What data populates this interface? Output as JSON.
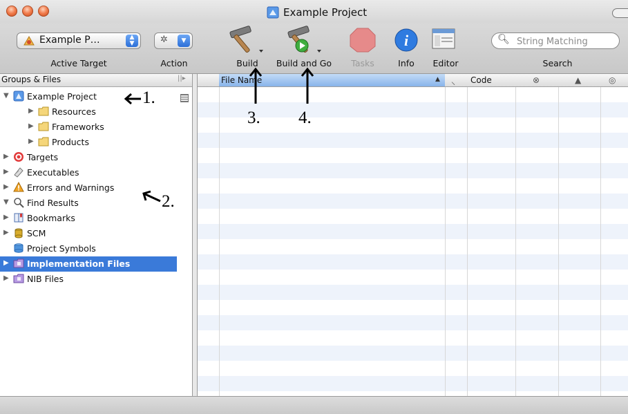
{
  "window": {
    "title": "Example Project"
  },
  "toolbar": {
    "active_target_value": "Example P…",
    "active_target_label": "Active Target",
    "action_label": "Action",
    "build_label": "Build",
    "build_and_go_label": "Build and Go",
    "tasks_label": "Tasks",
    "info_label": "Info",
    "editor_label": "Editor",
    "search_label": "Search",
    "search_placeholder": "String Matching"
  },
  "sidebar": {
    "header": "Groups & Files",
    "items": [
      {
        "label": "Example Project",
        "icon": "project-icon",
        "expanded": true,
        "indent": 0
      },
      {
        "label": "Resources",
        "icon": "folder-icon",
        "expanded": false,
        "indent": 1
      },
      {
        "label": "Frameworks",
        "icon": "folder-icon",
        "expanded": false,
        "indent": 1
      },
      {
        "label": "Products",
        "icon": "folder-icon",
        "expanded": false,
        "indent": 1
      },
      {
        "label": "Targets",
        "icon": "target-icon",
        "expanded": false,
        "indent": 0
      },
      {
        "label": "Executables",
        "icon": "executable-icon",
        "expanded": false,
        "indent": 0
      },
      {
        "label": "Errors and Warnings",
        "icon": "warning-icon",
        "expanded": false,
        "indent": 0
      },
      {
        "label": "Find Results",
        "icon": "magnifier-icon",
        "expanded": true,
        "indent": 0
      },
      {
        "label": "Bookmarks",
        "icon": "bookmarks-icon",
        "expanded": false,
        "indent": 0
      },
      {
        "label": "SCM",
        "icon": "scm-icon",
        "expanded": false,
        "indent": 0
      },
      {
        "label": "Project Symbols",
        "icon": "symbols-icon",
        "expanded": null,
        "indent": 0
      },
      {
        "label": "Implementation Files",
        "icon": "smart-group-icon",
        "expanded": false,
        "indent": 0,
        "selected": true
      },
      {
        "label": "NIB Files",
        "icon": "smart-group-icon",
        "expanded": false,
        "indent": 0
      }
    ]
  },
  "table": {
    "columns": {
      "file_name": "File Name",
      "code": "Code",
      "build_col_icon": "hammer-icon",
      "errors_col_icon": "error-icon",
      "warnings_col_icon": "warning-icon",
      "target_col_icon": "target-icon"
    },
    "rows": []
  },
  "annotations": {
    "a1": "1.",
    "a2": "2.",
    "a3": "3.",
    "a4": "4."
  },
  "colors": {
    "selection": "#3a7ad9",
    "stripe": "#eef3fb",
    "header_selected": "#88b4ea"
  }
}
